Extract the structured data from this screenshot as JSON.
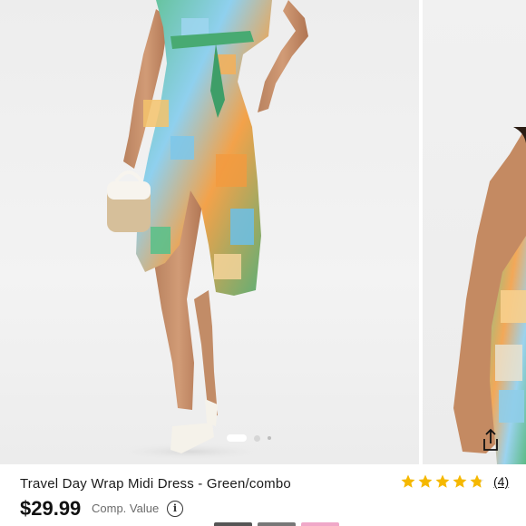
{
  "product": {
    "title": "Travel Day Wrap Midi Dress - Green/combo",
    "price": "$29.99",
    "comp_value_label": "Comp. Value",
    "info_icon": "info-icon"
  },
  "rating": {
    "value": 4.8,
    "max": 5,
    "count_label": "(4)",
    "star_color": "#f5b800"
  },
  "gallery": {
    "slide_count": 3,
    "active_index": 0,
    "share_icon": "share-icon"
  },
  "colors": {
    "dress_green": "#4db87a",
    "dress_blue": "#6fb3e6",
    "dress_orange": "#f19a3e"
  }
}
